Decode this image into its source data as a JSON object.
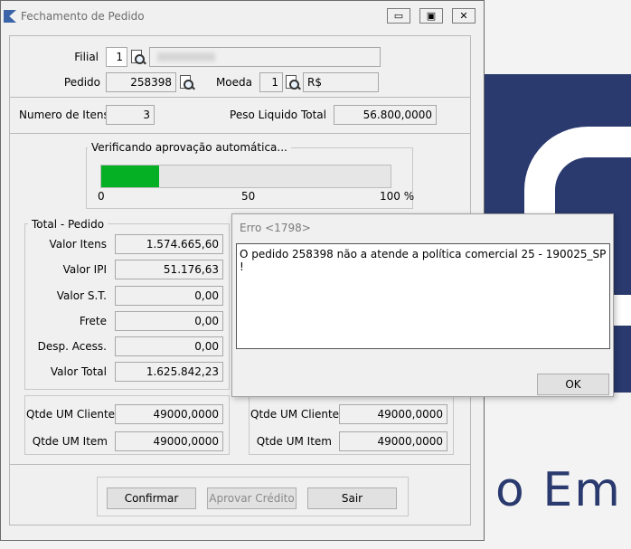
{
  "window": {
    "title": "Fechamento de Pedido",
    "minimize_glyph": "▭",
    "maximize_glyph": "▣",
    "close_glyph": "✕"
  },
  "header": {
    "filial_label": "Filial",
    "filial_value": "1",
    "pedido_label": "Pedido",
    "pedido_value": "258398",
    "moeda_label": "Moeda",
    "moeda_value": "1",
    "moeda_symbol": "R$"
  },
  "summary": {
    "numero_itens_label": "Numero de Itens",
    "numero_itens_value": "3",
    "peso_label": "Peso Liquido Total",
    "peso_value": "56.800,0000"
  },
  "progress": {
    "title": "Verificando aprovação automática...",
    "value": 0.2,
    "ticks": [
      "0",
      "50",
      "100 %"
    ],
    "fill_color": "#06b025"
  },
  "totals": {
    "title": "Total - Pedido",
    "rows": [
      {
        "label": "Valor Itens",
        "value": "1.574.665,60"
      },
      {
        "label": "Valor IPI",
        "value": "51.176,63"
      },
      {
        "label": "Valor S.T.",
        "value": "0,00"
      },
      {
        "label": "Frete",
        "value": "0,00"
      },
      {
        "label": "Desp. Acess.",
        "value": "0,00"
      },
      {
        "label": "Valor Total",
        "value": "1.625.842,23"
      }
    ],
    "qtde_left": [
      {
        "label": "Qtde UM Cliente",
        "value": "49000,0000"
      },
      {
        "label": "Qtde UM Item",
        "value": "49000,0000"
      }
    ],
    "qtde_right": [
      {
        "label": "Qtde UM Cliente",
        "value": "49000,0000"
      },
      {
        "label": "Qtde UM Item",
        "value": "49000,0000"
      }
    ]
  },
  "buttons": {
    "confirmar": "Confirmar",
    "aprovar": "Aprovar Crédito",
    "sair": "Sair"
  },
  "dialog": {
    "title": "Erro <1798>",
    "message": "O pedido 258398 não a atende a política comercial 25 - 190025_SP !",
    "ok": "OK"
  },
  "background": {
    "text": "o Em"
  }
}
